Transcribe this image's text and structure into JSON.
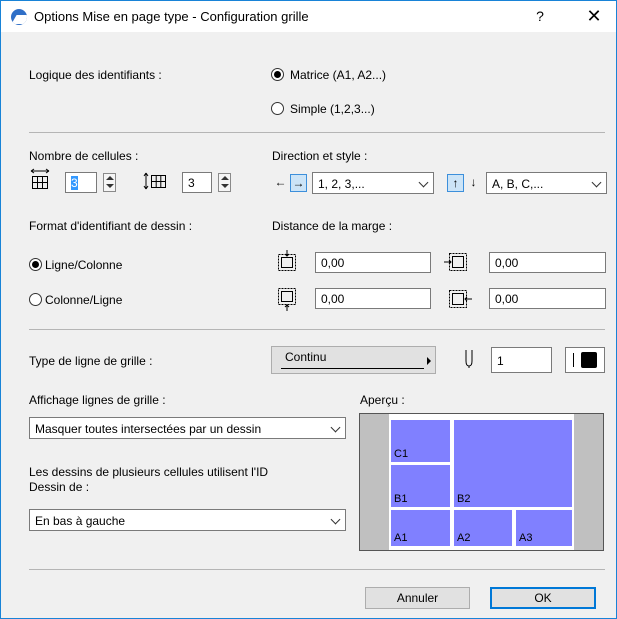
{
  "window": {
    "title": "Options Mise en page type  - Configuration grille",
    "help_label": "?",
    "close_label": "✕"
  },
  "identifiers": {
    "label": "Logique des identifiants :",
    "options": [
      {
        "label": "Matrice (A1, A2...)",
        "selected": true
      },
      {
        "label": "Simple (1,2,3...)",
        "selected": false
      }
    ]
  },
  "cells": {
    "label": "Nombre de cellules :",
    "columns_value": "3",
    "rows_value": "3"
  },
  "direction": {
    "label": "Direction et style :",
    "horizontal_style": "1, 2, 3,...",
    "vertical_style": "A, B, C,...",
    "left_arrow": "←",
    "right_arrow": "→",
    "up_arrow": "↑",
    "down_arrow": "↓"
  },
  "drawing_format": {
    "label": "Format d'identifiant de dessin :",
    "options": [
      {
        "label": "Ligne/Colonne",
        "selected": true
      },
      {
        "label": "Colonne/Ligne",
        "selected": false
      }
    ]
  },
  "margin": {
    "label": "Distance de la marge :",
    "top": "0,00",
    "right": "0,00",
    "bottom": "0,00",
    "left": "0,00"
  },
  "grid_line": {
    "label": "Type de ligne de grille :",
    "type_value": "Continu",
    "pen_value": "1",
    "pen_color": "#000000"
  },
  "display": {
    "label": "Affichage lignes de grille :",
    "value": "Masquer toutes intersectées par un dessin"
  },
  "multi_cell": {
    "label_line1": "Les dessins de plusieurs cellules utilisent l'ID",
    "label_line2": "Dessin de :",
    "value": "En bas à gauche"
  },
  "preview": {
    "label": "Aperçu :",
    "cells": [
      "C1",
      "B1",
      "B2",
      "A1",
      "A2",
      "A3"
    ],
    "cell_color": "#8080ff"
  },
  "buttons": {
    "cancel": "Annuler",
    "ok": "OK"
  }
}
